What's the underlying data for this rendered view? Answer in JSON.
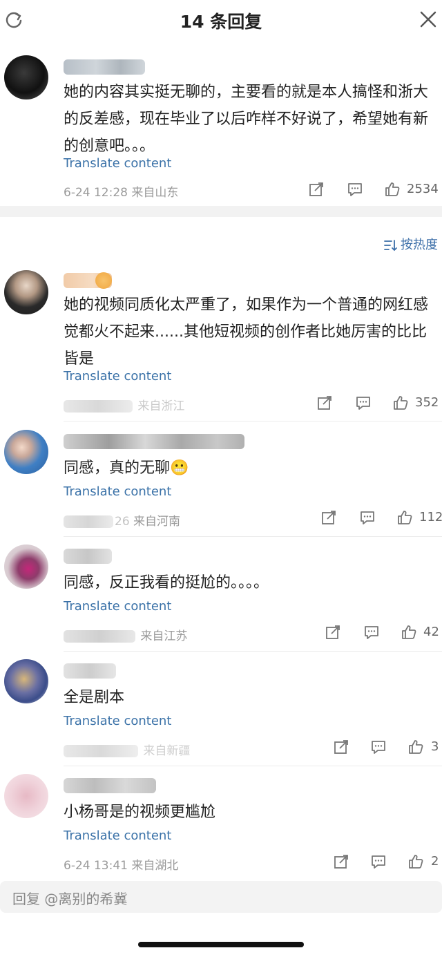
{
  "header": {
    "title": "14 条回复"
  },
  "top_comment": {
    "username": "离别的希冀",
    "text": "她的内容其实挺无聊的，主要看的就是本人搞怪和浙大的反差感，现在毕业了以后咋样不好说了，希望她有新的创意吧。。。",
    "translate": "Translate content",
    "date": "6-24 12:28",
    "location": "来自山东",
    "likes": "2534"
  },
  "sort_label": "按热度",
  "comments": [
    {
      "text": "她的视频同质化太严重了，如果作为一个普通的网红感觉都火不起来......其他短视频的创作者比她厉害的比比皆是",
      "translate": "Translate content",
      "location": "来自浙江",
      "likes": "352"
    },
    {
      "text": "同感，真的无聊😬",
      "translate": "Translate content",
      "time_partial": "26",
      "location": "来自河南",
      "likes": "112"
    },
    {
      "text": "同感，反正我看的挺尬的。。。。",
      "translate": "Translate content",
      "location": "来自江苏",
      "likes": "42"
    },
    {
      "text": "全是剧本",
      "translate": "Translate content",
      "location": "来自新疆",
      "likes": "3"
    },
    {
      "text": "小杨哥是的视频更尴尬",
      "translate": "Translate content",
      "date": "6-24 13:41",
      "location": "来自湖北",
      "likes": "2"
    }
  ],
  "reply_placeholder": "回复 @离别的希冀",
  "colors": {
    "link": "#3b72a8",
    "meta": "#9a9a9a",
    "text": "#222222"
  }
}
